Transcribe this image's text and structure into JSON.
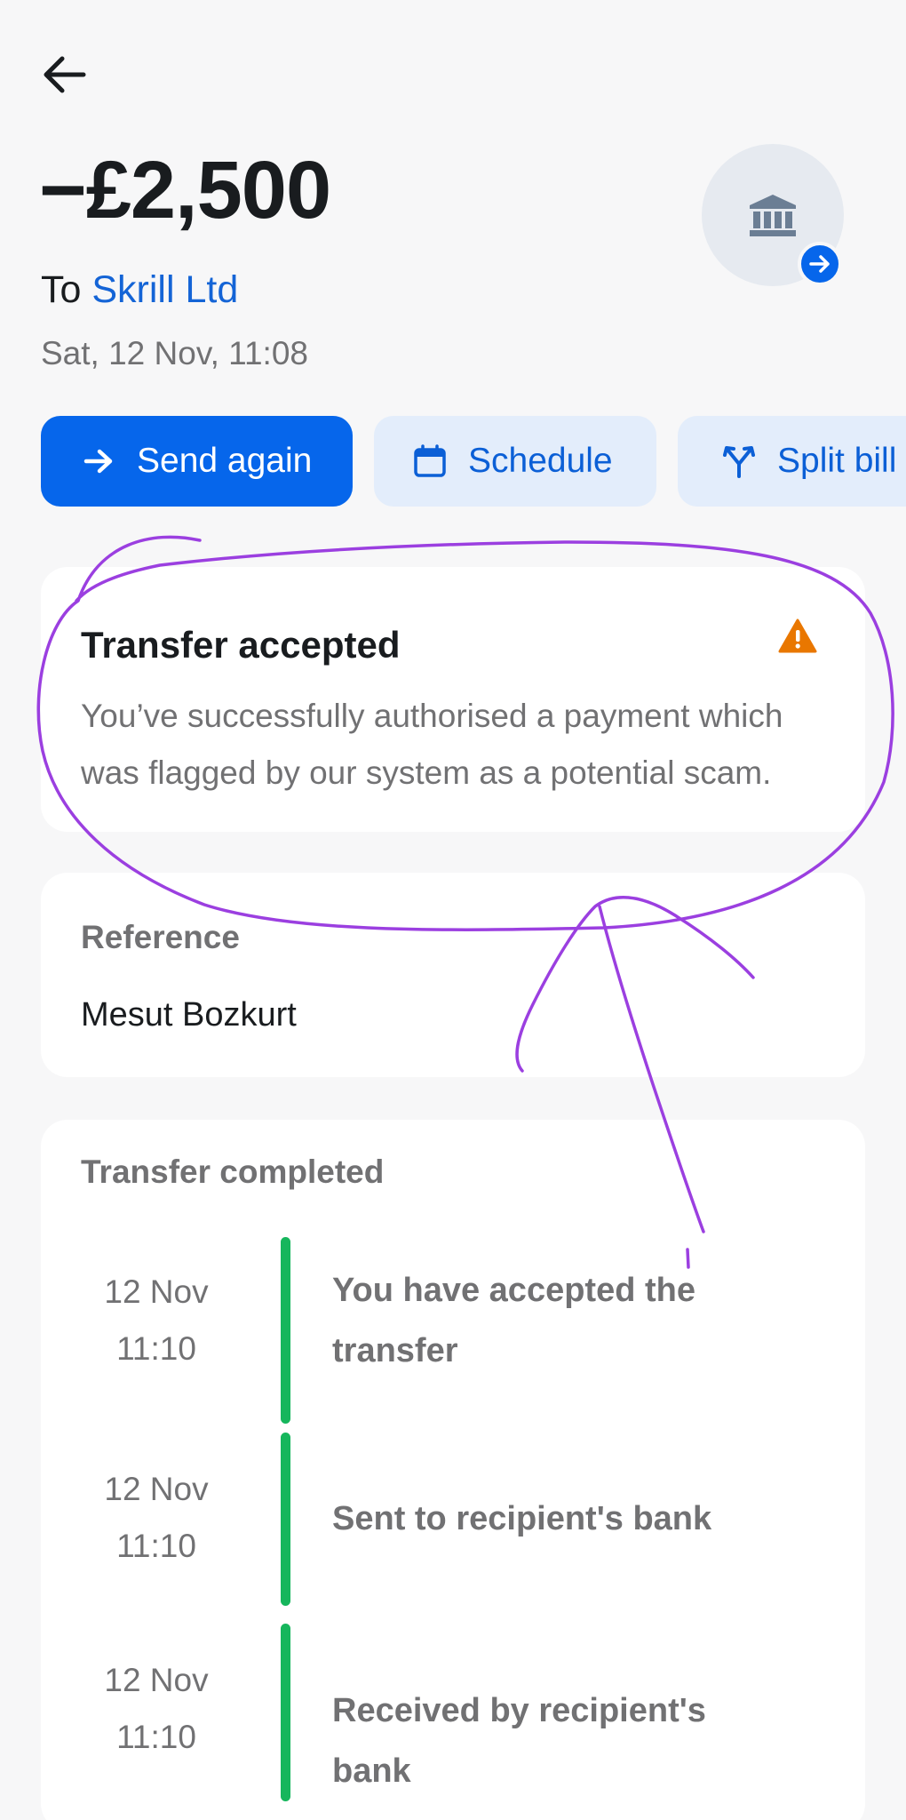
{
  "transaction": {
    "amount": "−£2,500",
    "to_prefix": "To",
    "recipient": "Skrill Ltd",
    "datetime": "Sat, 12 Nov, 11:08"
  },
  "actions": {
    "send_again": "Send again",
    "schedule": "Schedule",
    "split_bill": "Split bill"
  },
  "alert": {
    "title": "Transfer accepted",
    "body": "You’ve successfully authorised a payment which was flagged by our system as a potential scam."
  },
  "reference": {
    "label": "Reference",
    "value": "Mesut Bozkurt"
  },
  "timeline": {
    "title": "Transfer completed",
    "steps": [
      {
        "date": "12 Nov",
        "time": "11:10",
        "text": "You have accepted the transfer"
      },
      {
        "date": "12 Nov",
        "time": "11:10",
        "text": "Sent to recipient's bank"
      },
      {
        "date": "12 Nov",
        "time": "11:10",
        "text": "Received by recipient's bank"
      }
    ]
  },
  "colors": {
    "accent": "#0666eb",
    "status_success": "#16b65c",
    "warning": "#e97700",
    "annotation": "#9b3fe0"
  },
  "icons": {
    "back": "arrow-left-icon",
    "bank": "bank-icon",
    "badge": "arrow-right-circle-icon",
    "send": "arrow-right-icon",
    "schedule": "calendar-icon",
    "split": "split-icon",
    "alert": "warning-triangle-icon"
  }
}
